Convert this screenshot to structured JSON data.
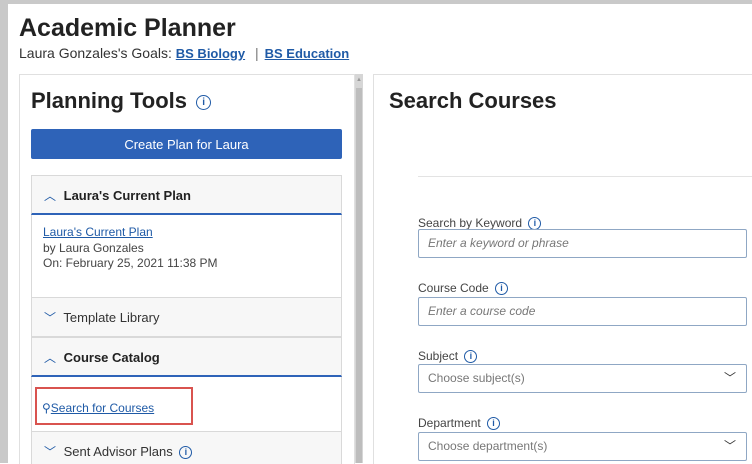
{
  "header": {
    "title": "Academic Planner",
    "goals_prefix": "Laura Gonzales's Goals:",
    "goal_1": "BS Biology",
    "goal_sep": "|",
    "goal_2": "BS Education"
  },
  "planning_tools": {
    "title": "Planning Tools",
    "create_button": "Create Plan for Laura",
    "current_plan_section": "Laura's Current Plan",
    "plan_link": "Laura's Current Plan",
    "plan_by": "by Laura Gonzales",
    "plan_on": "On: February 25, 2021 11:38 PM",
    "template_library": "Template Library",
    "course_catalog": "Course Catalog",
    "search_courses_link": "Search for Courses",
    "sent_advisor_plans": "Sent Advisor Plans"
  },
  "search_courses": {
    "title": "Search Courses",
    "keyword_label": "Search by Keyword",
    "keyword_placeholder": "Enter a keyword or phrase",
    "code_label": "Course Code",
    "code_placeholder": "Enter a course code",
    "subject_label": "Subject",
    "subject_value": "Choose subject(s)",
    "department_label": "Department",
    "department_value": "Choose department(s)"
  },
  "icons": {
    "info": "info-icon",
    "chevron_up": "chevron-up-icon",
    "chevron_down": "chevron-down-icon",
    "search": "search-icon"
  },
  "colors": {
    "primary_button": "#2e63b8",
    "link": "#1f5aa6",
    "highlight_box": "#d9534f"
  }
}
